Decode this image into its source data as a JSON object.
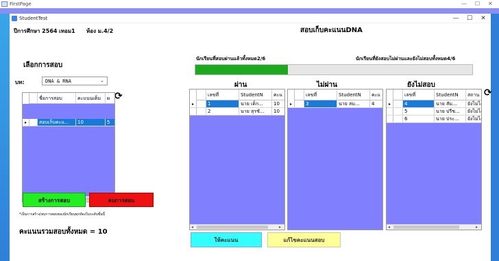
{
  "outer_window": {
    "title": "FirstPage"
  },
  "window": {
    "title": "StudentTest"
  },
  "header": {
    "year_label": "ปีการศึกษา 2564",
    "term_label": "เทอม1",
    "room_label": "ห้อง ม.4/2",
    "page_title": "สอบเก็บคะแนนDNA"
  },
  "left": {
    "section_title": "เลือกการสอบ",
    "chapter_label": "บท:",
    "chapter_value": "DNA & RNA",
    "exam_grid": {
      "columns": [
        "ชื่อการสอบ",
        "คะแนนเต็ม",
        "ผ"
      ],
      "rows": [
        [
          "สอบเก็บคะแ...",
          "10",
          "5"
        ]
      ]
    },
    "create_button": "สร้างการสอบ",
    "delete_button": "ลบการสอบ",
    "note": "*เป็นการสร้าง/ลบการสอบของนักเรียนทุกห้องในระดับชั้นนี้",
    "total_label": "คะแนนรวมสอบทั้งหมด = 10"
  },
  "progress": {
    "passed_label": "นักเรียนที่สอบผ่านแล้วทั้งหมด2/6",
    "remaining_label": "นักเรียนที่ยังสอบไม่ผ่านและยังไม่สอบทั้งหมด4/6",
    "fraction": 0.333
  },
  "panels": [
    {
      "title": "ผ่าน",
      "columns": [
        "เลขที่",
        "StudentN",
        "คะแ"
      ],
      "rows": [
        [
          "1",
          "นาย เด็ก...",
          "10"
        ],
        [
          "2",
          "นาย สุรชั...",
          "10"
        ]
      ]
    },
    {
      "title": "ไม่ผ่าน",
      "columns": [
        "เลขที่",
        "StudentN",
        "คะแ"
      ],
      "rows": [
        [
          "3",
          "นาย สม...",
          "4"
        ]
      ]
    },
    {
      "title": "ยังไม่สอบ",
      "columns": [
        "เลขที่",
        "StudentN",
        "สถาน"
      ],
      "rows": [
        [
          "4",
          "นาย สัม...",
          "ยังไม่ได"
        ],
        [
          "5",
          "นาย ปรีช...",
          "ยังไม่ได"
        ],
        [
          "6",
          "นาย ประ...",
          "ยังไม่ได"
        ]
      ]
    }
  ],
  "buttons": {
    "give_score": "ให้คะแนน",
    "edit_score": "แก้ไขคะแนนสอบ"
  },
  "colors": {
    "grid_bg": "#8080ff",
    "selected_row": "#1a7ad8",
    "progress_fill": "#1ea81e",
    "create_btn": "#22ee22",
    "delete_btn": "#ee1111",
    "give_score_btn": "#33ffff",
    "edit_score_btn": "#ffff99"
  },
  "icons": [
    "refresh-icon",
    "minimize-icon",
    "maximize-icon",
    "close-icon",
    "chevron-down-icon",
    "row-pointer-icon"
  ]
}
